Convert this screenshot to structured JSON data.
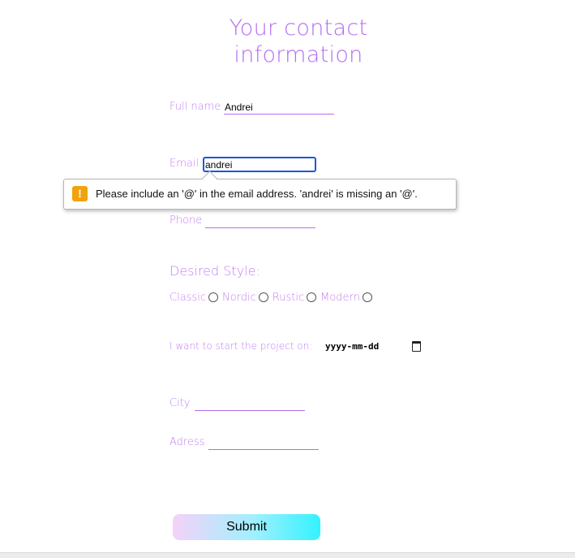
{
  "page": {
    "title_line1": "Your contact",
    "title_line2": "information"
  },
  "form": {
    "full_name_label": "Full name",
    "full_name_value": "Andrei",
    "email_label": "Email",
    "email_value": "andrei",
    "phone_label": "Phone",
    "phone_value": "",
    "desired_style_heading": "Desired Style:",
    "styles": [
      {
        "label": "Classic"
      },
      {
        "label": "Nordic"
      },
      {
        "label": "Rustic"
      },
      {
        "label": "Modern"
      }
    ],
    "start_date_label": "I want to start the project on:",
    "start_date_value": "yyyy-mm-dd",
    "city_label": "City",
    "city_value": "",
    "address_label": "Adress",
    "address_value": "",
    "submit_label": "Submit"
  },
  "validation": {
    "message": "Please include an '@' in the email address. 'andrei' is missing an '@'.",
    "icon": "warning-icon",
    "icon_glyph": "!",
    "icon_color": "#f3a20c"
  },
  "colors": {
    "accent": "#b36df0",
    "focus_border": "#1b57d8"
  }
}
